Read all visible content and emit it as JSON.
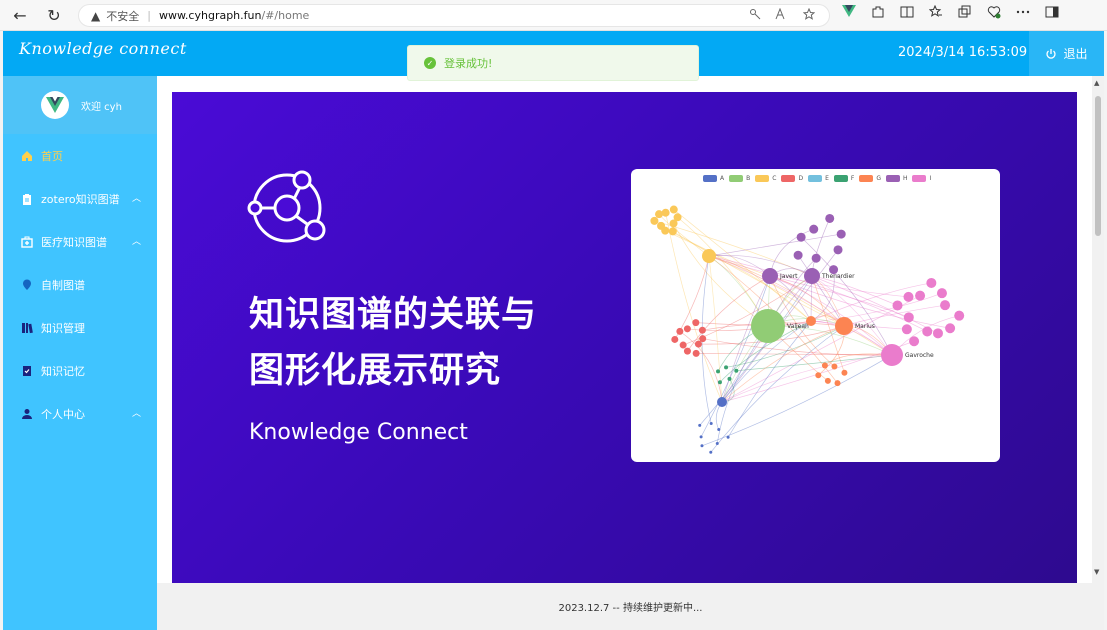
{
  "browser": {
    "back_icon": "←",
    "reload_icon": "↻",
    "warning_icon": "▲",
    "insecure_label": "不安全",
    "separator": "|",
    "host": "www.cyhgraph.fun",
    "path": "/#/home"
  },
  "app": {
    "brand": "Knowledge connect",
    "datetime": "2024/3/14 16:53:09",
    "logout_label": "退出"
  },
  "toast": {
    "message": "登录成功!"
  },
  "sidebar": {
    "welcome": "欢迎 cyh",
    "items": [
      {
        "label": "首页",
        "icon": "home-icon",
        "active": true
      },
      {
        "label": "zotero知识图谱",
        "icon": "clipboard-icon",
        "has_submenu": true
      },
      {
        "label": "医疗知识图谱",
        "icon": "medical-kit-icon",
        "has_submenu": true
      },
      {
        "label": "自制图谱",
        "icon": "location-pin-icon"
      },
      {
        "label": "知识管理",
        "icon": "book-icon"
      },
      {
        "label": "知识记忆",
        "icon": "checklist-icon"
      },
      {
        "label": "个人中心",
        "icon": "user-icon",
        "has_submenu": true
      }
    ]
  },
  "banner": {
    "title_line1": "知识图谱的关联与",
    "title_line2": "图形化展示研究",
    "subtitle": "Knowledge Connect"
  },
  "graph": {
    "legend": [
      "A",
      "B",
      "C",
      "D",
      "E",
      "F",
      "G",
      "H",
      "I"
    ],
    "legend_colors": [
      "#5470c6",
      "#91cc75",
      "#fac858",
      "#ee6666",
      "#73c0de",
      "#3ba272",
      "#fc8452",
      "#9a60b4",
      "#ea7ccc"
    ],
    "labels": [
      "Javert",
      "Thenardier",
      "Valjean",
      "Marius",
      "Gavroche"
    ]
  },
  "footer": {
    "text": "2023.12.7 -- 持续维护更新中..."
  }
}
